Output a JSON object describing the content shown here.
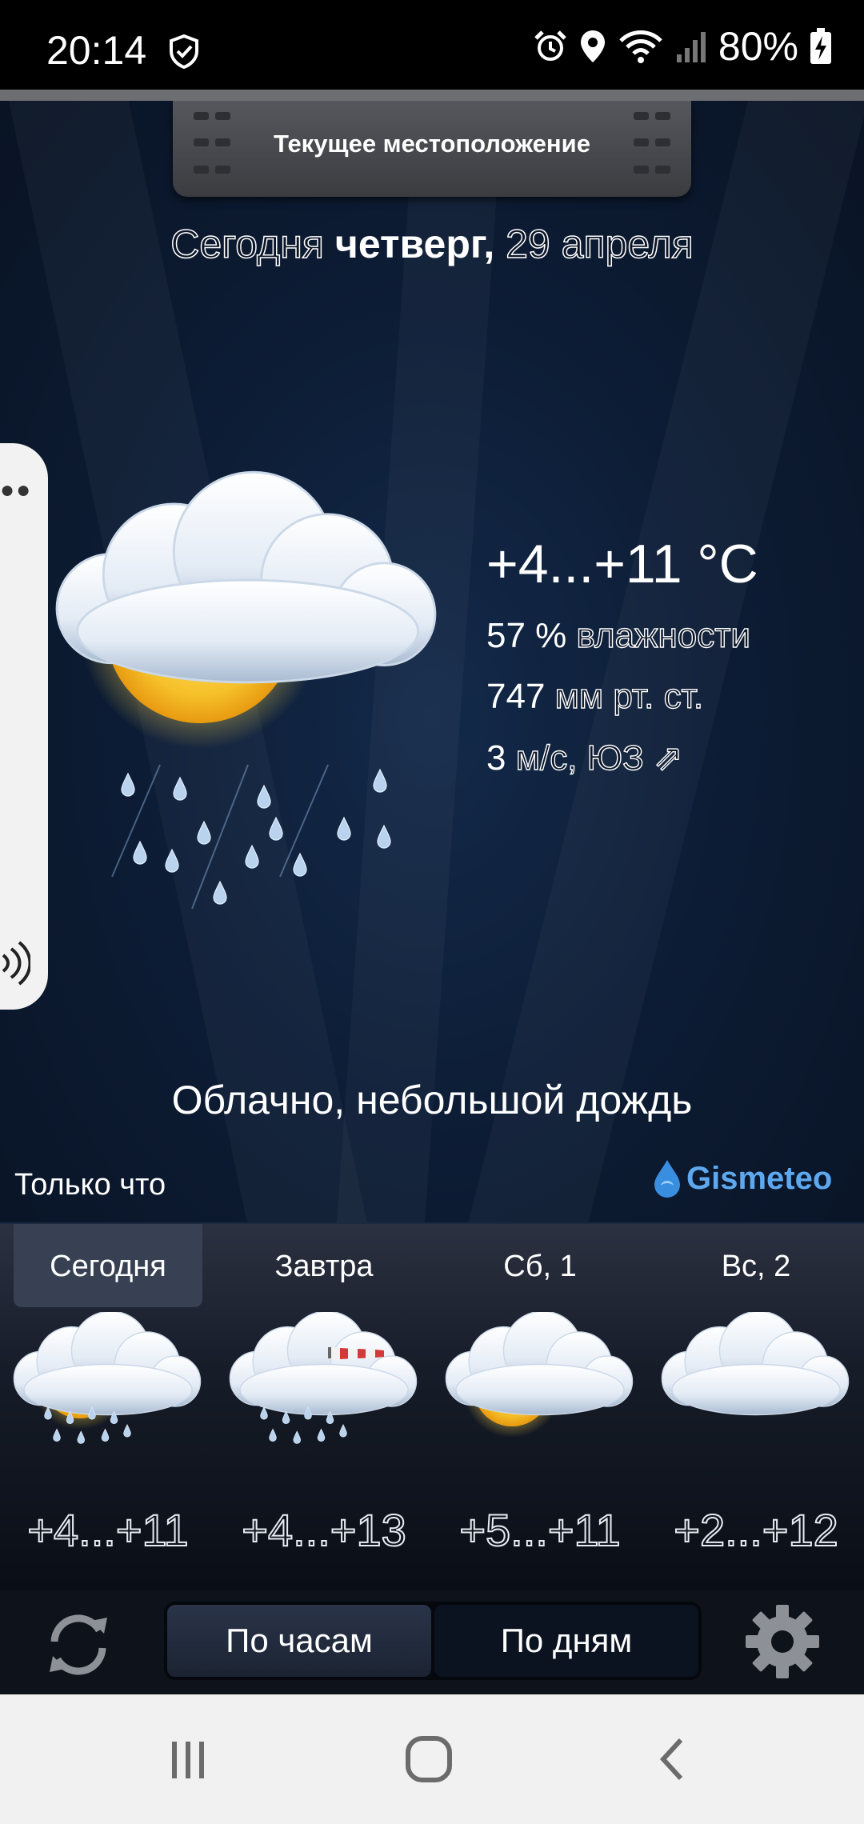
{
  "status_bar": {
    "time": "20:14",
    "battery": "80%",
    "icons": [
      "shield-check-icon",
      "alarm-icon",
      "location-pin-icon",
      "wifi-icon",
      "signal-icon",
      "battery-charging-icon"
    ]
  },
  "header": {
    "location": "Текущее местоположение"
  },
  "date": {
    "prefix": "Сегодня",
    "weekday": "четверг,",
    "date": "29 апреля"
  },
  "current": {
    "temperature": "+4...+11 °C",
    "humidity_value": "57 %",
    "humidity_label": "влажности",
    "pressure_value": "747",
    "pressure_label": "мм рт. ст.",
    "wind_value": "3",
    "wind_label": "м/с, ЮЗ",
    "wind_arrow": "⇗",
    "condition": "Облачно, небольшой дождь",
    "updated": "Только что",
    "icon": "partly-cloudy-rain-icon"
  },
  "brand": {
    "name": "Gismeteo",
    "color": "#5da8ee"
  },
  "forecast": {
    "days": [
      {
        "label": "Сегодня",
        "temp": "+4...+11",
        "icon": "sun-cloud-rain-icon",
        "active": true
      },
      {
        "label": "Завтра",
        "temp": "+4...+13",
        "icon": "cloud-rain-wind-icon",
        "active": false
      },
      {
        "label": "Сб, 1",
        "temp": "+5...+11",
        "icon": "sun-cloud-icon",
        "active": false
      },
      {
        "label": "Вс, 2",
        "temp": "+2...+12",
        "icon": "cloud-icon",
        "active": false
      }
    ]
  },
  "toolbar": {
    "hourly_label": "По часам",
    "daily_label": "По дням",
    "selected": "hourly"
  },
  "navbar": {
    "icons": [
      "recent-apps-icon",
      "home-icon",
      "back-icon"
    ]
  }
}
